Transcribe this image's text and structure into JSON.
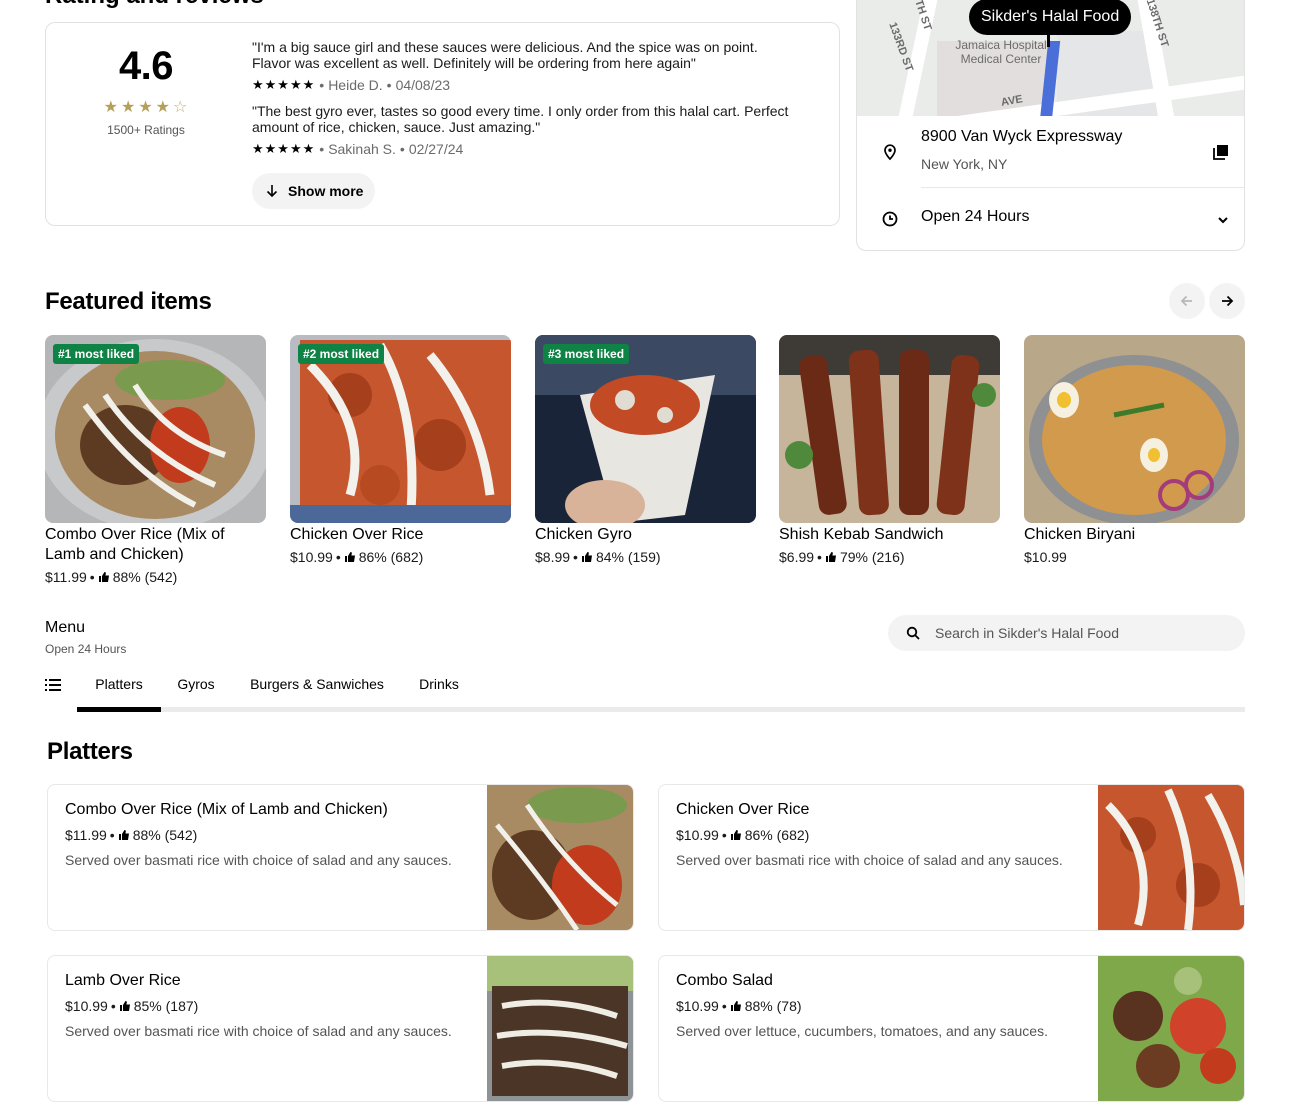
{
  "ratings_section": {
    "heading": "Rating and reviews",
    "score": "4.6",
    "rating_count": "1500+ Ratings",
    "reviews": [
      {
        "text": "\"I'm a big sauce girl and these sauces were delicious. And the spice was on point. Flavor was excellent as well. Definitely will be ordering from here again\"",
        "author": "Heide D.",
        "date": "04/08/23"
      },
      {
        "text": "\"The best gyro ever, tastes so good every time. I only order from this halal cart. Perfect amount of rice, chicken, sauce. Just amazing.\"",
        "author": "Sakinah S.",
        "date": "02/27/24"
      }
    ],
    "show_more_label": "Show more"
  },
  "location": {
    "pin_label": "Sikder's Halal Food",
    "map_labels": {
      "street_1": "133RD ST",
      "street_2": "138TH ST",
      "street_3": "TH ST",
      "ave": "AVE",
      "hospital": "Jamaica Hospital Medical Center"
    },
    "address": "8900 Van Wyck Expressway",
    "city": "New York, NY",
    "hours": "Open 24 Hours"
  },
  "featured": {
    "title": "Featured items",
    "items": [
      {
        "badge": "#1 most liked",
        "name": "Combo Over Rice (Mix of Lamb and Chicken)",
        "price": "$11.99",
        "rating": "88% (542)"
      },
      {
        "badge": "#2 most liked",
        "name": "Chicken Over Rice",
        "price": "$10.99",
        "rating": "86% (682)"
      },
      {
        "badge": "#3 most liked",
        "name": "Chicken Gyro",
        "price": "$8.99",
        "rating": "84% (159)"
      },
      {
        "badge": "",
        "name": "Shish Kebab Sandwich",
        "price": "$6.99",
        "rating": "79% (216)"
      },
      {
        "badge": "",
        "name": "Chicken Biryani",
        "price": "$10.99",
        "rating": ""
      }
    ]
  },
  "menu": {
    "title": "Menu",
    "subtitle": "Open 24 Hours",
    "search_placeholder": "Search in Sikder's Halal Food",
    "tabs": [
      "Platters",
      "Gyros",
      "Burgers & Sanwiches",
      "Drinks"
    ],
    "active_tab": "Platters",
    "section_title": "Platters",
    "items": [
      {
        "name": "Combo Over Rice (Mix of Lamb and Chicken)",
        "price": "$11.99",
        "rating": "88% (542)",
        "description": "Served over basmati rice with choice of salad and any sauces."
      },
      {
        "name": "Chicken Over Rice",
        "price": "$10.99",
        "rating": "86% (682)",
        "description": "Served over basmati rice with choice of salad and any sauces."
      },
      {
        "name": "Lamb Over Rice",
        "price": "$10.99",
        "rating": "85% (187)",
        "description": "Served over basmati rice with choice of salad and any sauces."
      },
      {
        "name": "Combo Salad",
        "price": "$10.99",
        "rating": "88% (78)",
        "description": "Served over lettuce, cucumbers, tomatoes, and any sauces."
      }
    ]
  },
  "colors": {
    "badge_green": "#0e8345",
    "map_route_blue": "#4a6fd8",
    "star_gold": "#b5a05a"
  },
  "icons": [
    "location-pin-icon",
    "clock-icon",
    "copy-icon",
    "chevron-down-icon",
    "arrow-left-icon",
    "arrow-right-icon",
    "search-icon",
    "list-icon",
    "thumbs-up-icon",
    "star-icon",
    "arrow-down-icon"
  ]
}
